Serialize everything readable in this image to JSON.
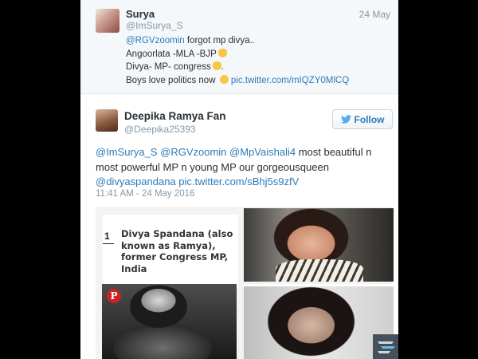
{
  "reply_tweet": {
    "name": "Surya",
    "handle": "@ImSurya_S",
    "date": "24 May",
    "lines": [
      {
        "link": "@RGVzoomin",
        "text": " forgot mp divya.."
      },
      {
        "text": "Angoorlata -MLA -BJP"
      },
      {
        "text": "Divya- MP- congress"
      },
      {
        "text": "Boys love politics now ",
        "link": "pic.twitter.com/mIQZY0MlCQ"
      }
    ]
  },
  "main_tweet": {
    "name": "Deepika Ramya Fan",
    "handle": "@Deepika25393",
    "follow_label": "Follow",
    "text_lines": [
      {
        "links": [
          "@ImSurya_S",
          "@RGVzoomin",
          "@MpVaishali4"
        ],
        "text": " most beautiful n"
      },
      {
        "text": "most powerful MP n young MP our gorgeousqueen"
      },
      {
        "links": [
          "@divyaspandana",
          "pic.twitter.com/sBhj5s9zfV"
        ]
      }
    ],
    "timestamp": "11:41 AM - 24 May 2016"
  },
  "media": {
    "list_number": "1",
    "caption": "Divya Spandana (also known as Ramya), former Congress MP, India",
    "pin_label": "P"
  },
  "colors": {
    "link": "#2b7bb9",
    "muted": "#8899a6",
    "text": "#292f33",
    "pinterest": "#cb2027"
  },
  "icons": [
    "twitter-bird-icon",
    "pinterest-icon",
    "emoji-icon",
    "corner-logo-icon"
  ]
}
